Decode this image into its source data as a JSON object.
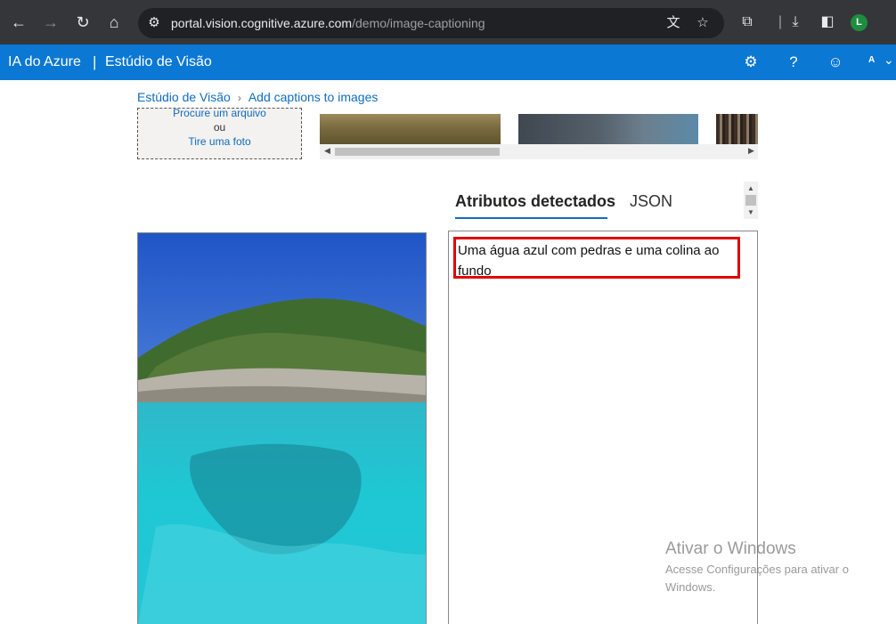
{
  "browser": {
    "url_host": "portal.vision.cognitive.azure.com",
    "url_path": "/demo/image-captioning",
    "profile_initial": "L",
    "icons": [
      "back-icon",
      "forward-icon",
      "reload-icon",
      "home-icon",
      "site-info-icon",
      "translate-icon",
      "star-icon",
      "extensions-icon",
      "download-icon",
      "side-panel-icon",
      "profile-avatar"
    ]
  },
  "header": {
    "brand": "IA do Azure",
    "separator": "|",
    "studio": "Estúdio de Visão",
    "user_initial": "A",
    "accent_color": "#0b78d4"
  },
  "breadcrumb": {
    "home": "Estúdio de Visão",
    "current": "Add captions to images"
  },
  "upload": {
    "browse": "Procure um arquivo",
    "or": "ou",
    "take_photo": "Tire uma foto"
  },
  "tabs": [
    {
      "label": "Atributos detectados",
      "active": true
    },
    {
      "label": "JSON",
      "active": false
    }
  ],
  "result": {
    "caption": "Uma água azul com pedras e uma colina ao fundo",
    "highlight_color": "#e00000"
  },
  "watermark": {
    "title": "Ativar o Windows",
    "subtitle": "Acesse Configurações para ativar o Windows."
  }
}
